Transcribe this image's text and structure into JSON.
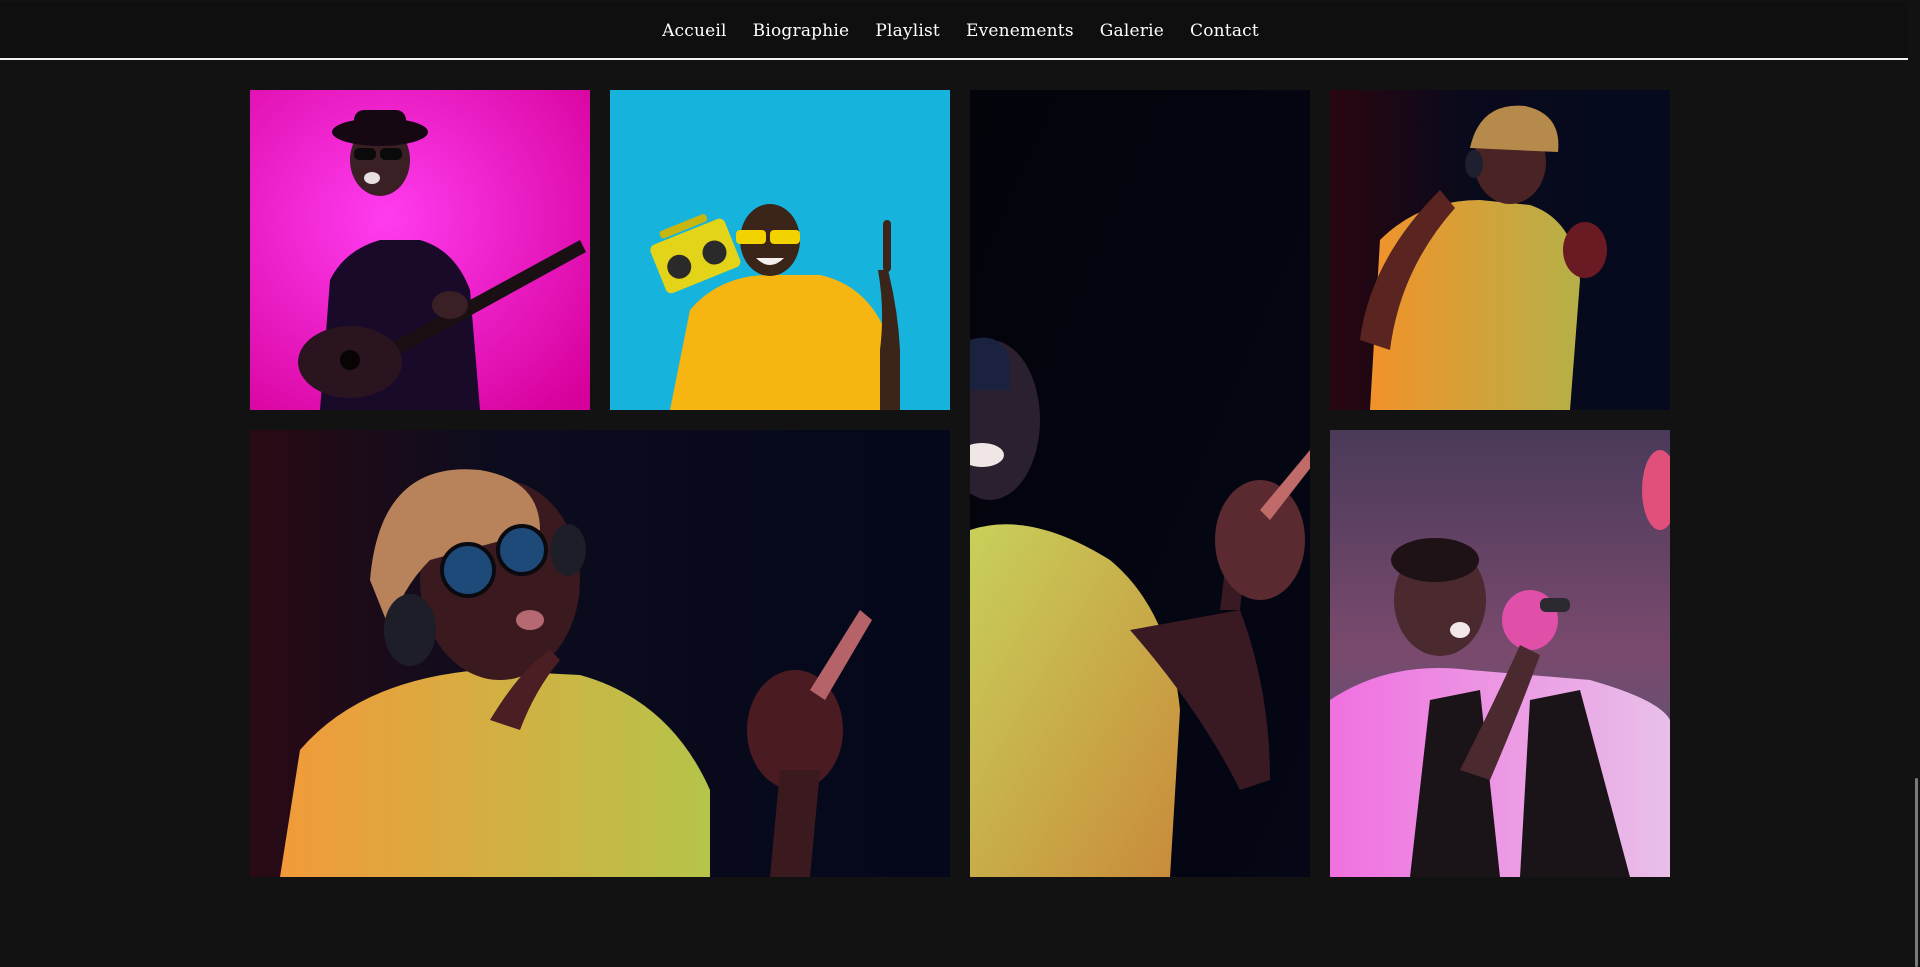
{
  "nav": {
    "items": [
      "Accueil",
      "Biographie",
      "Playlist",
      "Evenements",
      "Galerie",
      "Contact"
    ]
  },
  "gallery": {
    "photos": [
      {
        "subject": "guitarist-in-hat-on-magenta",
        "bg": "#f020d8"
      },
      {
        "subject": "man-with-boombox-on-cyan",
        "bg": "#1ab4dd"
      },
      {
        "subject": "man-pointing-in-neon-light-tall",
        "bg": "#05060f"
      },
      {
        "subject": "man-with-headphones-dancing",
        "bg": "#0a0d1c"
      },
      {
        "subject": "man-in-sunglasses-pointing-wide",
        "bg": "#070a18"
      },
      {
        "subject": "man-singing-with-microphone",
        "bg": "#6a4c74"
      }
    ]
  },
  "colors": {
    "background": "#121212",
    "nav_bg": "#0f0f0f",
    "nav_text": "#ffffff",
    "nav_border": "#f2f2f2"
  }
}
